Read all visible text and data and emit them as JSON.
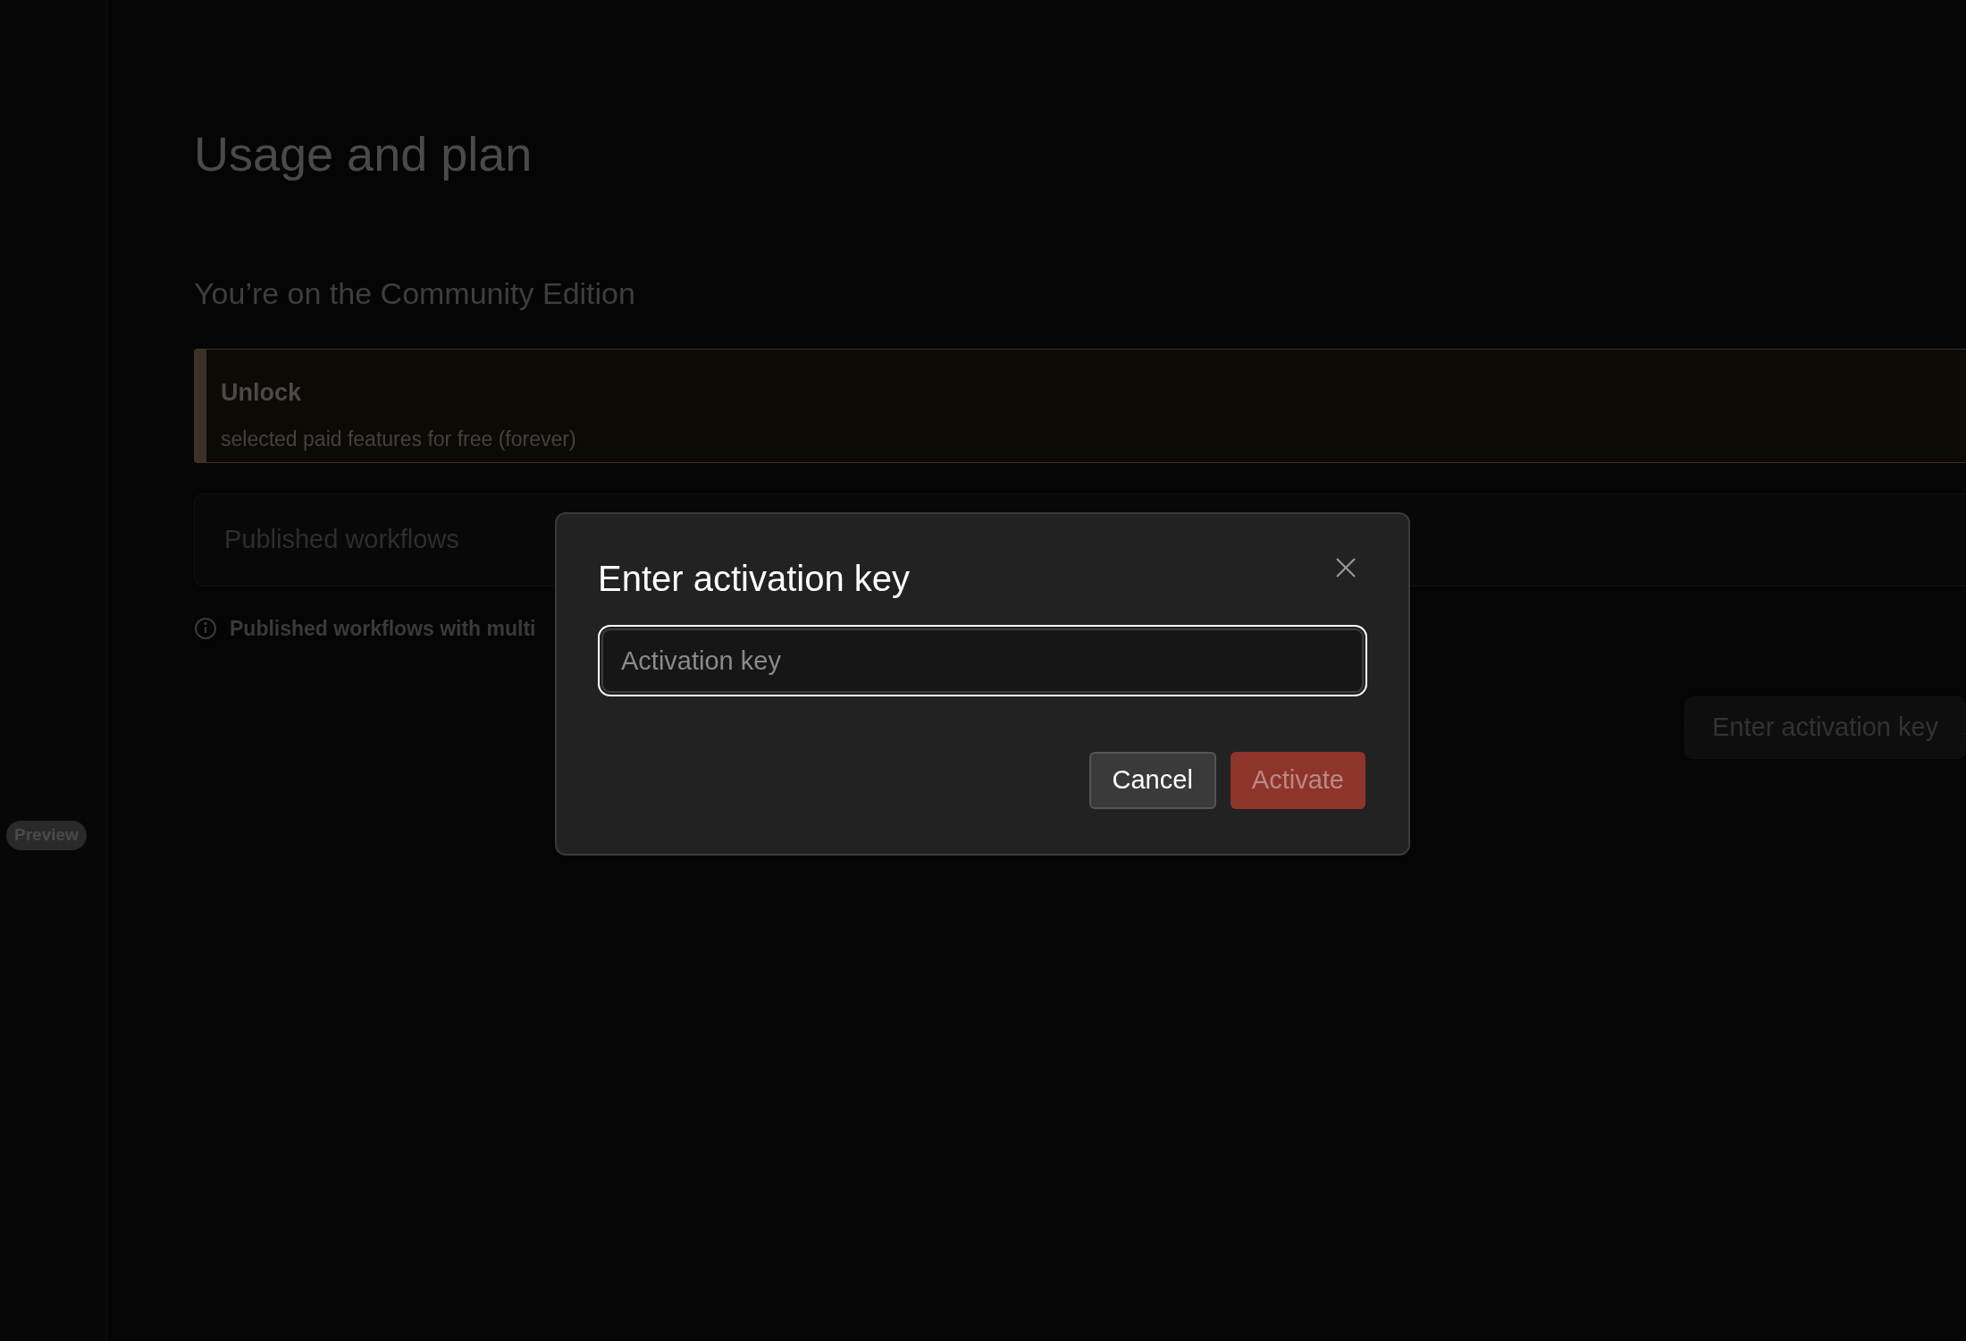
{
  "sidebar": {
    "badge": "Preview"
  },
  "page": {
    "title": "Usage and plan",
    "subtitle": "You’re on the Community Edition",
    "banner": {
      "title": "Unlock",
      "text": "selected paid features for free (forever)"
    },
    "card": {
      "label": "Published workflows"
    },
    "note": "Published workflows with multi",
    "button": "Enter activation key"
  },
  "dialog": {
    "title": "Enter activation key",
    "field": {
      "placeholder": "Activation key",
      "focused": true
    },
    "buttons": [
      {
        "label": "Cancel",
        "kind": "secondary",
        "disabled": false
      },
      {
        "label": "Activate",
        "kind": "primary",
        "disabled": true
      }
    ]
  }
}
